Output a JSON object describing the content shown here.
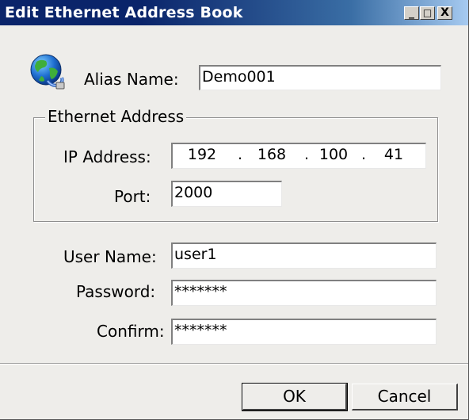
{
  "window": {
    "title": "Edit Ethernet Address Book",
    "buttons": {
      "minimize": "_",
      "maximize": "□",
      "close": "X"
    }
  },
  "alias": {
    "label": "Alias Name:",
    "value": "Demo001"
  },
  "ethernet_group": {
    "title": "Ethernet Address",
    "ip_label": "IP Address:",
    "ip_octets": [
      "192",
      "168",
      "100",
      "41"
    ],
    "ip_separator": ".",
    "port_label": "Port:",
    "port_value": "2000"
  },
  "credentials": {
    "user_label": "User Name:",
    "user_value": "user1",
    "password_label": "Password:",
    "password_value": "*******",
    "confirm_label": "Confirm:",
    "confirm_value": "*******"
  },
  "actions": {
    "ok": "OK",
    "cancel": "Cancel"
  },
  "icon": {
    "name": "globe-network-icon"
  }
}
